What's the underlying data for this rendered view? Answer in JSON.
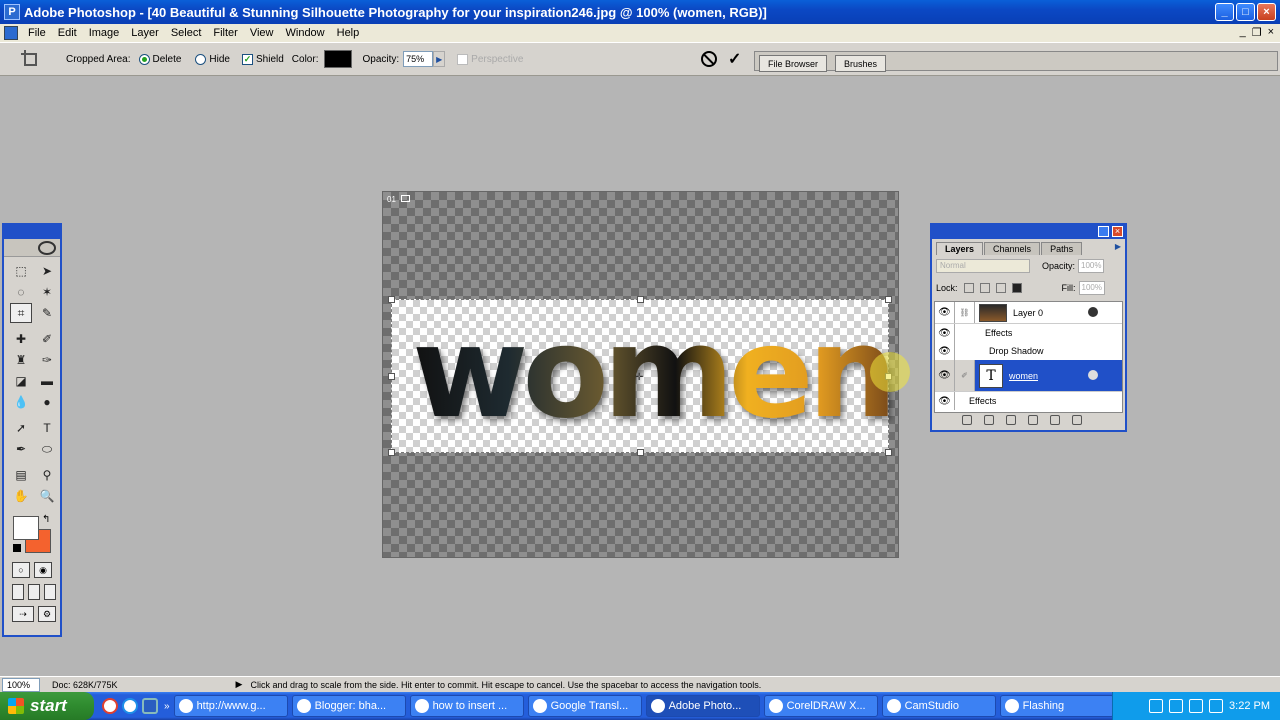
{
  "titlebar": {
    "title": "Adobe Photoshop - [40 Beautiful & Stunning Silhouette Photography for your inspiration246.jpg @ 100% (women, RGB)]",
    "min": "_",
    "max": "□",
    "close": "×"
  },
  "menu": [
    "File",
    "Edit",
    "Image",
    "Layer",
    "Select",
    "Filter",
    "View",
    "Window",
    "Help"
  ],
  "mdi": {
    "min": "_",
    "restore": "❐",
    "close": "×"
  },
  "options": {
    "cropped_area_label": "Cropped Area:",
    "delete_label": "Delete",
    "hide_label": "Hide",
    "shield_label": "Shield",
    "color_label": "Color:",
    "shield_color": "#000000",
    "opacity_label": "Opacity:",
    "opacity_value": "75%",
    "perspective_label": "Perspective",
    "well_tabs": [
      "File Browser",
      "Brushes"
    ]
  },
  "document": {
    "tag": "01",
    "text": "women"
  },
  "layers": {
    "tabs": [
      "Layers",
      "Channels",
      "Paths"
    ],
    "blend_mode": "Normal",
    "opacity_label": "Opacity:",
    "opacity_value": "100%",
    "lock_label": "Lock:",
    "fill_label": "Fill:",
    "fill_value": "100%",
    "rows": [
      {
        "name": "Layer 0",
        "effects": "Effects",
        "effect": "Drop Shadow"
      },
      {
        "name": "women",
        "effects": "Effects"
      }
    ]
  },
  "status": {
    "zoom": "100%",
    "doc": "Doc: 628K/775K",
    "message": "Click and drag to scale from the side. Hit enter to commit. Hit escape to cancel. Use the spacebar to access the navigation tools."
  },
  "taskbar": {
    "start": "start",
    "buttons": [
      "http://www.g...",
      "Blogger: bha...",
      "how to insert ...",
      "Google Transl...",
      "Adobe Photo...",
      "CorelDRAW X...",
      "CamStudio",
      "Flashing"
    ],
    "clock": "3:22 PM"
  },
  "colors": {
    "foreground": "#ffffff",
    "background": "#f4622e"
  }
}
